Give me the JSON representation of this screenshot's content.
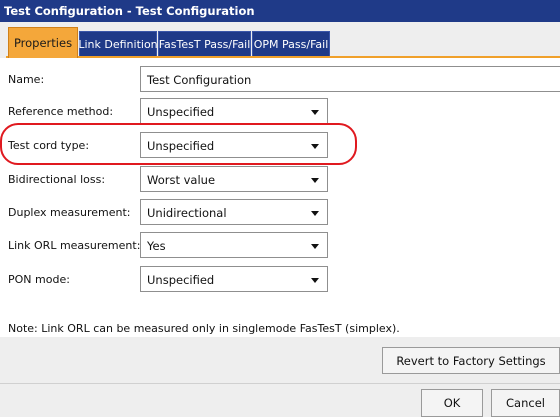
{
  "window": {
    "title": "Test Configuration - Test Configuration"
  },
  "tabs": [
    {
      "label": "Properties",
      "active": true
    },
    {
      "label": "Link Definition",
      "active": false
    },
    {
      "label": "FasTesT Pass/Fail",
      "active": false
    },
    {
      "label": "OPM Pass/Fail",
      "active": false
    }
  ],
  "form": {
    "name": {
      "label": "Name:",
      "value": "Test Configuration"
    },
    "reference_method": {
      "label": "Reference method:",
      "value": "Unspecified"
    },
    "test_cord_type": {
      "label": "Test cord type:",
      "value": "Unspecified"
    },
    "bidirectional_loss": {
      "label": "Bidirectional loss:",
      "value": "Worst value"
    },
    "duplex_measurement": {
      "label": "Duplex measurement:",
      "value": "Unidirectional"
    },
    "link_orl_measurement": {
      "label": "Link ORL measurement:",
      "value": "Yes"
    },
    "pon_mode": {
      "label": "PON mode:",
      "value": "Unspecified"
    }
  },
  "note": "Note: Link ORL can be measured only in singlemode FasTesT (simplex).",
  "buttons": {
    "revert": "Revert to Factory Settings",
    "ok": "OK",
    "cancel": "Cancel"
  },
  "colors": {
    "titlebar": "#1f3a88",
    "active_tab": "#f4a73a",
    "inactive_tab": "#1f3a88",
    "highlight": "#e0191f"
  },
  "icons": {
    "dropdown": "chevron-down-icon"
  }
}
